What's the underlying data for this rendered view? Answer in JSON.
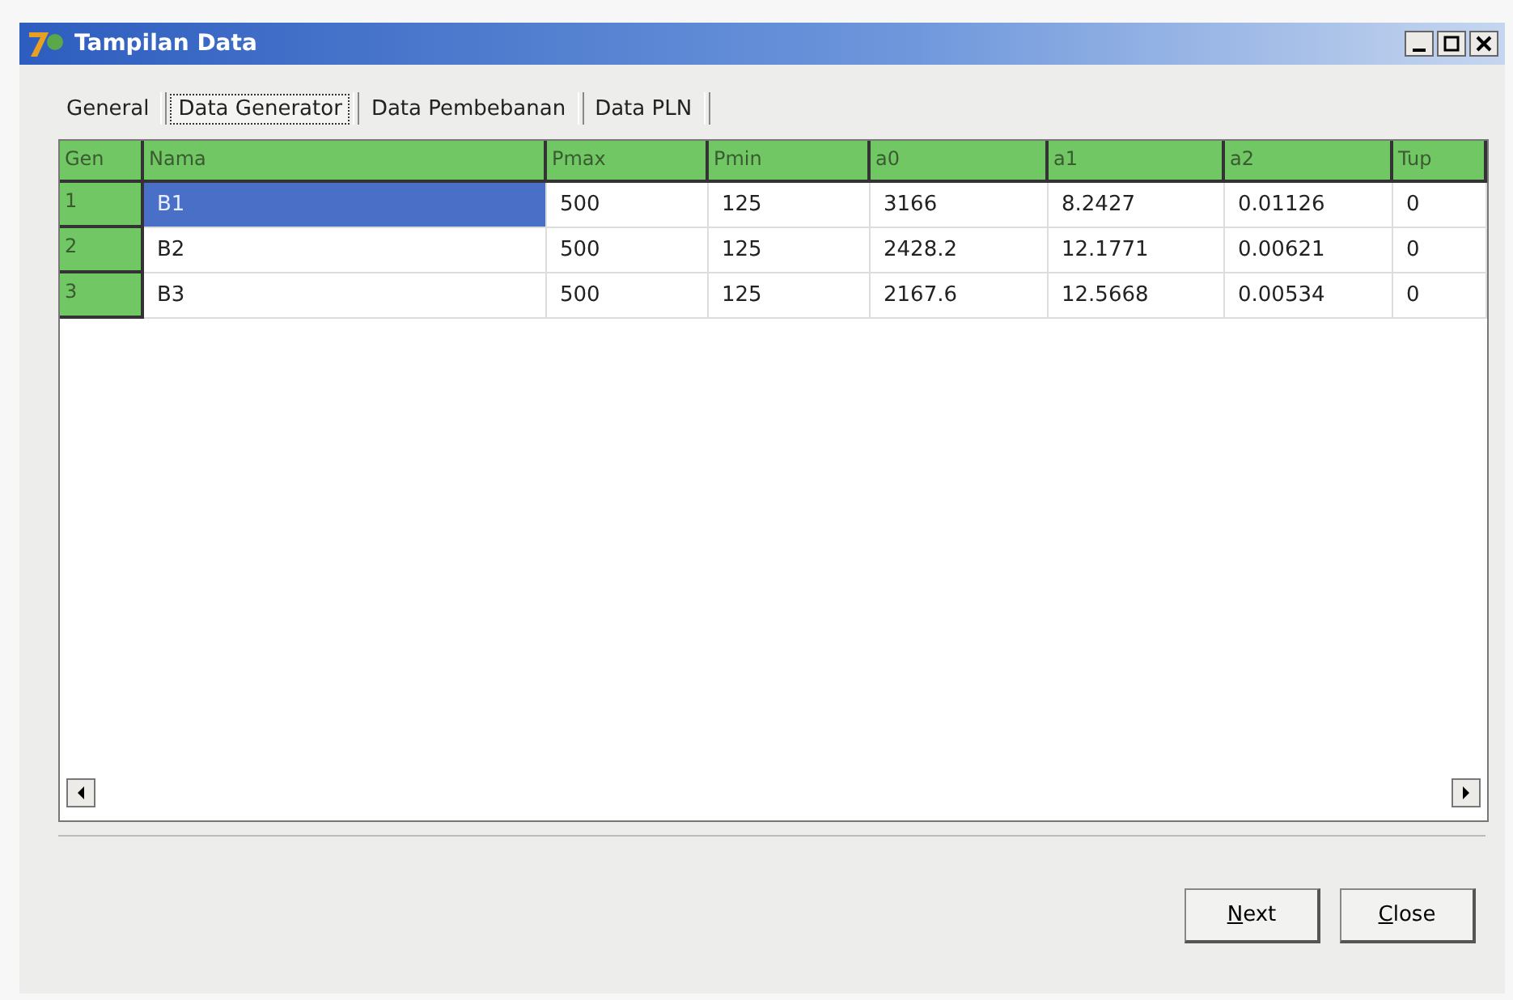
{
  "window": {
    "title": "Tampilan Data"
  },
  "tabs": [
    {
      "label": "General",
      "selected": false
    },
    {
      "label": "Data Generator",
      "selected": true
    },
    {
      "label": "Data Pembebanan",
      "selected": false
    },
    {
      "label": "Data PLN",
      "selected": false
    }
  ],
  "table": {
    "columns": [
      "Gen",
      "Nama",
      "Pmax",
      "Pmin",
      "a0",
      "a1",
      "a2",
      "Tup"
    ],
    "rows": [
      {
        "selected": true,
        "cells": [
          "1",
          "B1",
          "500",
          "125",
          "3166",
          "8.2427",
          "0.01126",
          "0"
        ]
      },
      {
        "selected": false,
        "cells": [
          "2",
          "B2",
          "500",
          "125",
          "2428.2",
          "12.1771",
          "0.00621",
          "0"
        ]
      },
      {
        "selected": false,
        "cells": [
          "3",
          "B3",
          "500",
          "125",
          "2167.6",
          "12.5668",
          "0.00534",
          "0"
        ]
      }
    ]
  },
  "buttons": [
    "Next",
    "Close"
  ]
}
